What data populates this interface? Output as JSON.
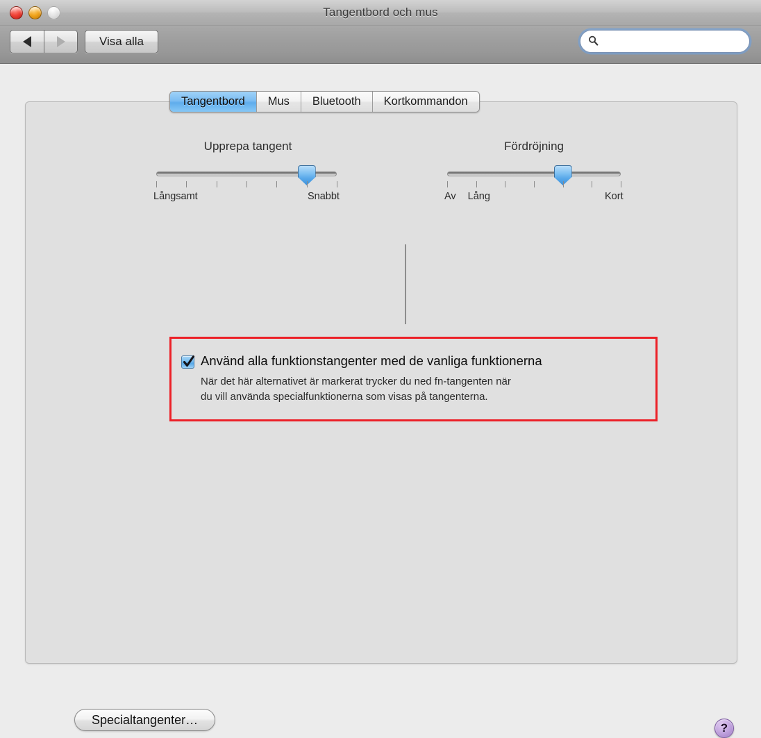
{
  "window": {
    "title": "Tangentbord och mus",
    "traffic_lights": [
      {
        "name": "close",
        "color": "#ef4135"
      },
      {
        "name": "minimize",
        "color": "#f0a41c"
      },
      {
        "name": "zoom",
        "color": "#e3e3e3"
      }
    ]
  },
  "toolbar": {
    "back_label": "◀",
    "forward_label": "▶",
    "show_all_label": "Visa alla",
    "search": {
      "icon": "search-icon",
      "value": "",
      "placeholder": ""
    }
  },
  "tabs": [
    {
      "label": "Tangentbord",
      "active": true
    },
    {
      "label": "Mus",
      "active": false
    },
    {
      "label": "Bluetooth",
      "active": false
    },
    {
      "label": "Kortkommandon",
      "active": false
    }
  ],
  "sliders": [
    {
      "name": "key-repeat",
      "title": "Upprepa tangent",
      "tick_count": 7,
      "value_index": 6,
      "labels": [
        {
          "text": "Långsamt",
          "tick": 1
        },
        {
          "text": "Snabbt",
          "tick": 7
        }
      ]
    },
    {
      "name": "delay-until-repeat",
      "title": "Fördröjning",
      "tick_count": 7,
      "value_index": 5,
      "labels": [
        {
          "text": "Av",
          "tick": 1
        },
        {
          "text": "Lång",
          "tick": 2
        },
        {
          "text": "Kort",
          "tick": 7
        }
      ]
    }
  ],
  "highlight": {
    "color": "#ec2027",
    "visible": true
  },
  "function_keys": {
    "checked": true,
    "label": "Använd alla funktionstangenter med de vanliga funktionerna",
    "description_line1": "När det här alternativet är markerat trycker du ned fn-tangenten när",
    "description_line2": "du vill använda specialfunktionerna som visas på tangenterna."
  },
  "footer": {
    "modifier_keys_label": "Specialtangenter…",
    "help_label": "?"
  }
}
